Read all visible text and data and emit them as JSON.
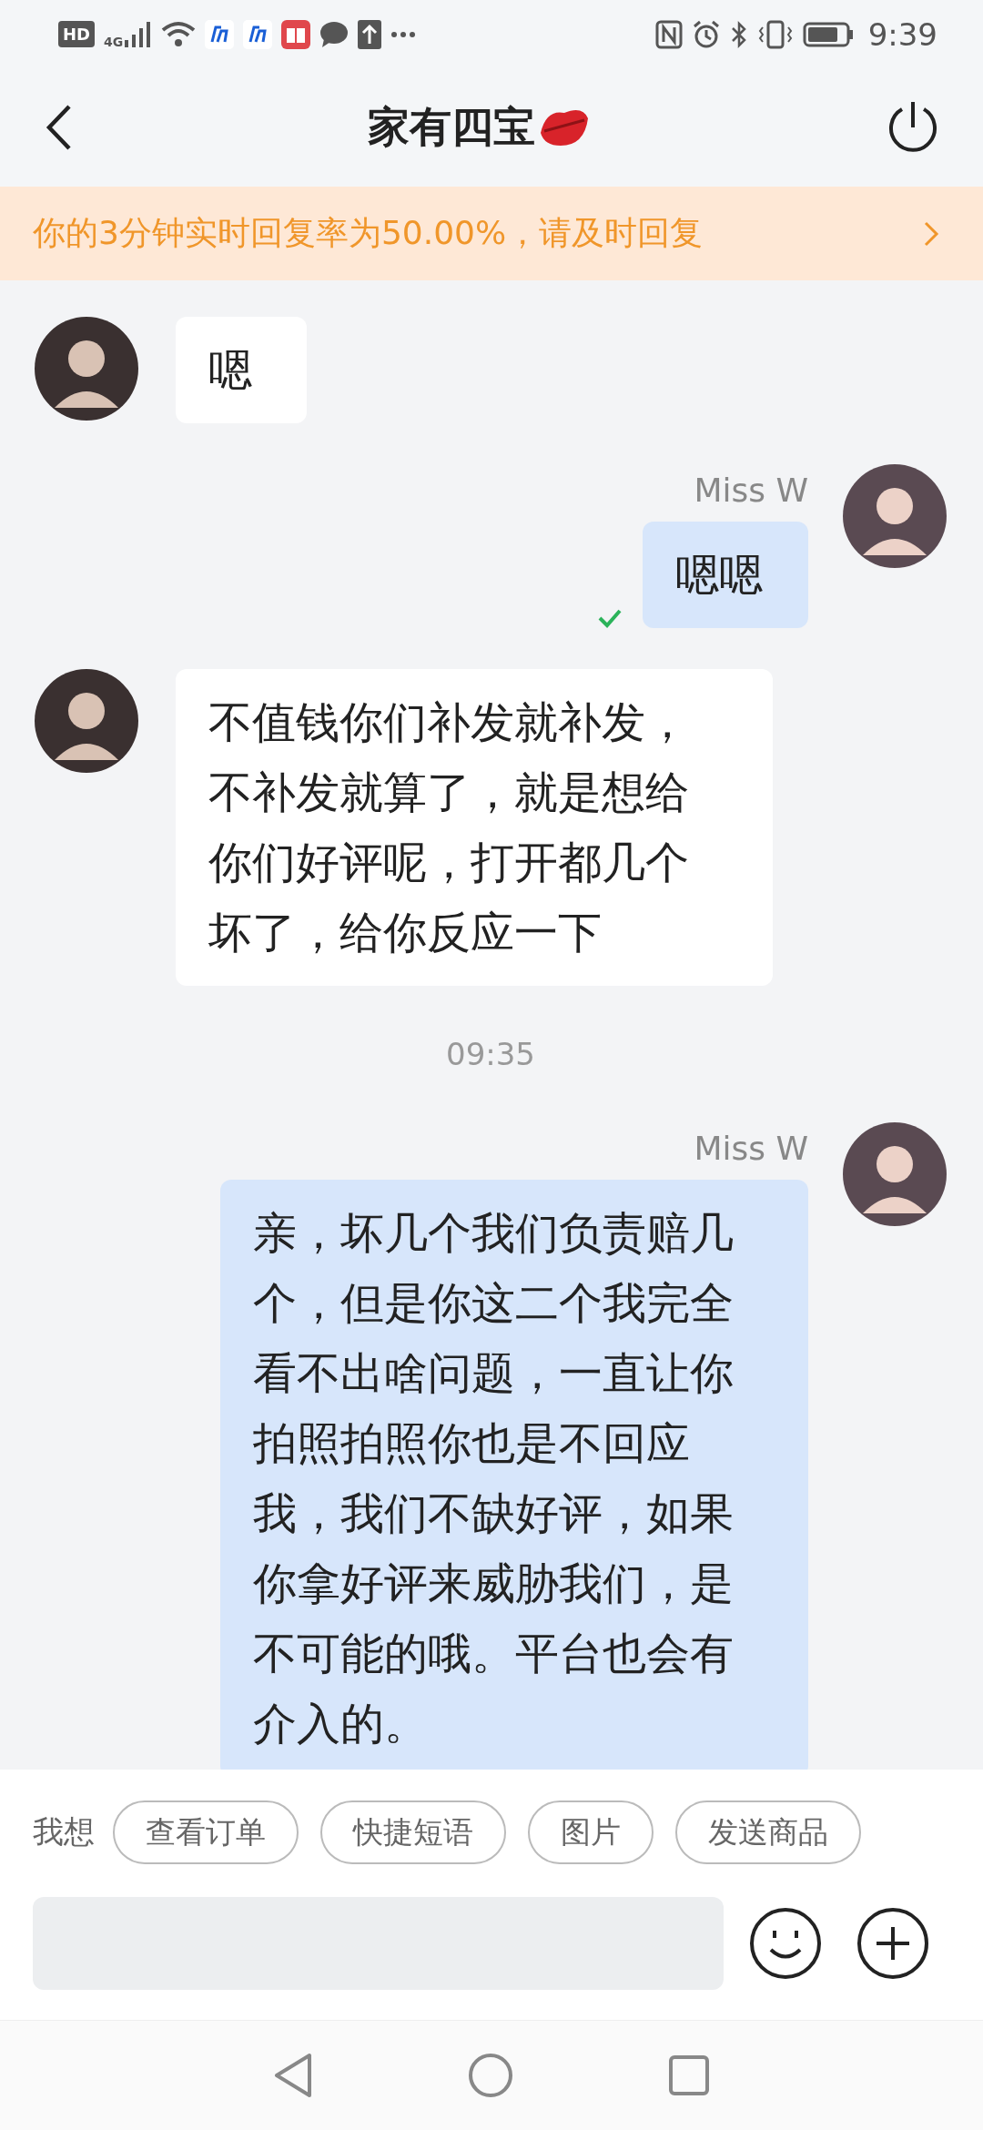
{
  "status_bar": {
    "hd": "HD",
    "network": "4G",
    "time": "9:39"
  },
  "header": {
    "title": "家有四宝"
  },
  "notice": {
    "text": "你的3分钟实时回复率为50.00%，请及时回复"
  },
  "messages": [
    {
      "kind": "received",
      "text": "嗯"
    },
    {
      "kind": "sent",
      "sender": "Miss W",
      "text": "嗯嗯",
      "read": true
    },
    {
      "kind": "received",
      "text": "不值钱你们补发就补发，不补发就算了，就是想给你们好评呢，打开都几个坏了，给你反应一下"
    },
    {
      "kind": "time",
      "text": "09:35"
    },
    {
      "kind": "sent",
      "sender": "Miss W",
      "text": "亲，坏几个我们负责赔几个，但是你这二个我完全看不出啥问题，一直让你拍照拍照你也是不回应我，我们不缺好评，如果你拿好评来威胁我们，是不可能的哦。平台也会有介入的。"
    }
  ],
  "quick_actions": {
    "label": "我想",
    "items": [
      "查看订单",
      "快捷短语",
      "图片",
      "发送商品"
    ]
  }
}
